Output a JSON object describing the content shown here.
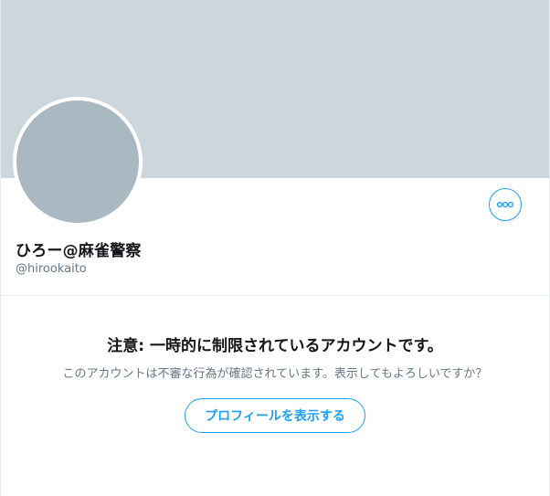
{
  "profile": {
    "display_name": "ひろー@麻雀警察",
    "handle": "@hirookaito",
    "more_icon": "more-horizontal-icon"
  },
  "notice": {
    "title": "注意: 一時的に制限されているアカウントです。",
    "body": "このアカウントは不審な行為が確認されています。表示してもよろしいですか？",
    "button_label": "プロフィールを表示する"
  },
  "colors": {
    "accent": "#1da1f2",
    "banner": "#ccd6dd",
    "avatar": "#aab8c2",
    "secondary_text": "#657786",
    "primary_text": "#14171a"
  }
}
